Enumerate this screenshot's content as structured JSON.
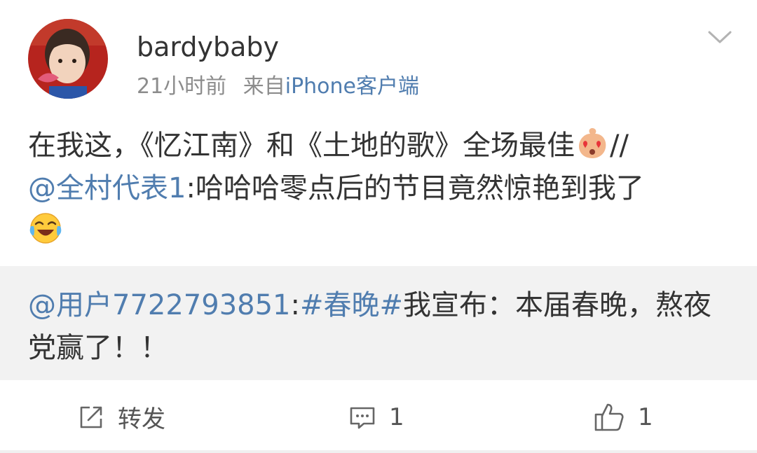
{
  "post": {
    "username": "bardybaby",
    "time": "21小时前",
    "source_prefix": "来自",
    "source_client": "iPhone客户端",
    "text": {
      "line1_main": "在我这，《忆江南》和《土地的歌》全场最佳",
      "line1_separator": "//",
      "line2_mention": "@全村代表1",
      "line2_text": ":哈哈哈零点后的节目竟然惊艳到我了"
    },
    "emojis": [
      "heart-eyes-emoji",
      "laughing-tears-emoji"
    ]
  },
  "repost": {
    "line1_mention": "@用户7722793851",
    "line1_colon": ":",
    "line1_hashtag": "#春晚#",
    "line1_text": "我宣布：本届春晚，熬夜",
    "line2_text": "党赢了！！"
  },
  "actions": {
    "repost_label": "转发",
    "comment_count": "1",
    "like_count": "1"
  },
  "icons": [
    "avatar",
    "chevron-down-icon",
    "repost-icon",
    "comment-icon",
    "like-icon"
  ],
  "colors": {
    "text": "#333333",
    "meta": "#8c8c8c",
    "link": "#507daf",
    "repost_bg": "#f2f2f2"
  }
}
